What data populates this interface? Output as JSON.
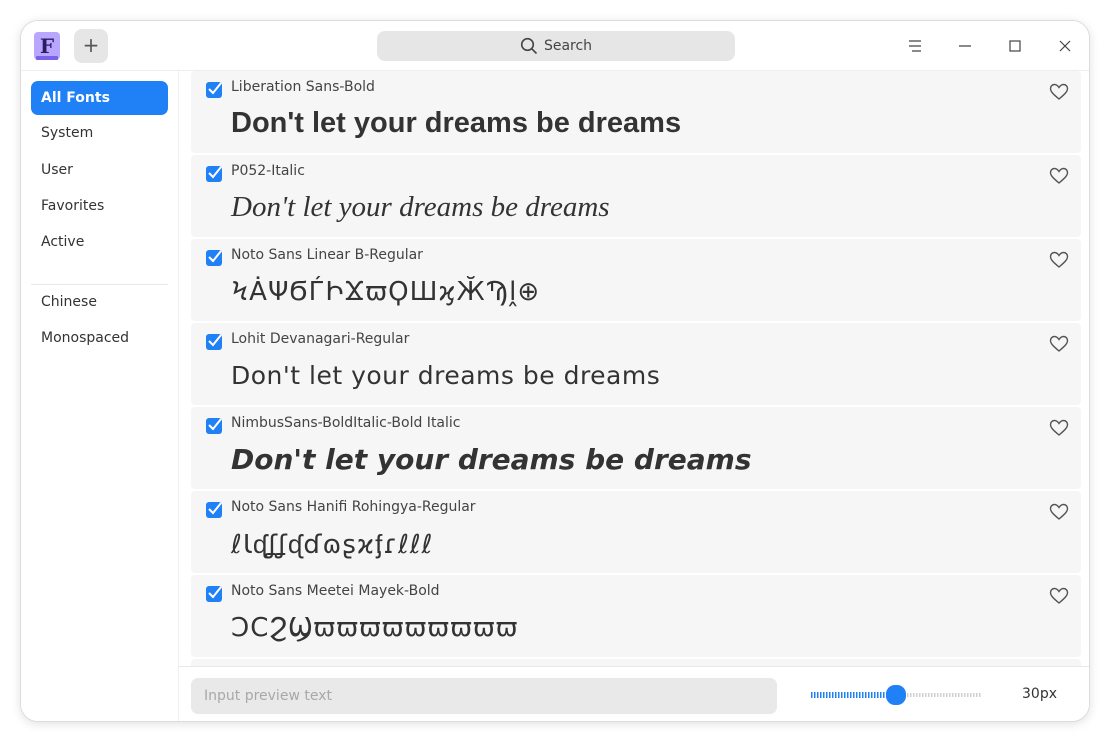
{
  "header": {
    "add_label": "+",
    "search_label": "Search"
  },
  "sidebar": {
    "items": [
      {
        "label": "All Fonts",
        "active": true
      },
      {
        "label": "System",
        "active": false
      },
      {
        "label": "User",
        "active": false
      },
      {
        "label": "Favorites",
        "active": false
      },
      {
        "label": "Active",
        "active": false
      }
    ],
    "groups": [
      {
        "label": "Chinese"
      },
      {
        "label": "Monospaced"
      }
    ]
  },
  "fonts": [
    {
      "name": "Liberation Sans-Bold",
      "preview": "Don't let your dreams be dreams"
    },
    {
      "name": "P052-Italic",
      "preview": "Don't let your dreams be dreams"
    },
    {
      "name": "Noto Sans Linear B-Regular",
      "preview": "ϞȦΨϬЃԻϪϖϘШϗӁϠḽ⊕"
    },
    {
      "name": "Lohit Devanagari-Regular",
      "preview": "Don't let your dreams be dreams"
    },
    {
      "name": "NimbusSans-BoldItalic-Bold Italic",
      "preview": "Don't let your dreams be dreams"
    },
    {
      "name": "Noto Sans Hanifi Rohingya-Regular",
      "preview": "ℓƖᶑʆʆᶑɗɷʂϰᶂɾℓℓℓ"
    },
    {
      "name": "Noto Sans Meetei Mayek-Bold",
      "preview": "ϽϹϨϢϖϖϖϖϖϖϖϖϖ"
    }
  ],
  "footer": {
    "preview_placeholder": "Input preview text",
    "size_value": 30,
    "size_min": 0,
    "size_max": 60,
    "size_label": "30px"
  },
  "colors": {
    "accent": "#1f81f5",
    "card_bg": "#f6f6f6"
  },
  "icons": {
    "logo": "font-manager-logo-icon",
    "search": "search-icon",
    "menu": "menu-icon",
    "minimize": "minimize-icon",
    "maximize": "maximize-icon",
    "close": "close-icon",
    "favorite": "heart-icon",
    "check": "checkbox-checked-icon"
  }
}
